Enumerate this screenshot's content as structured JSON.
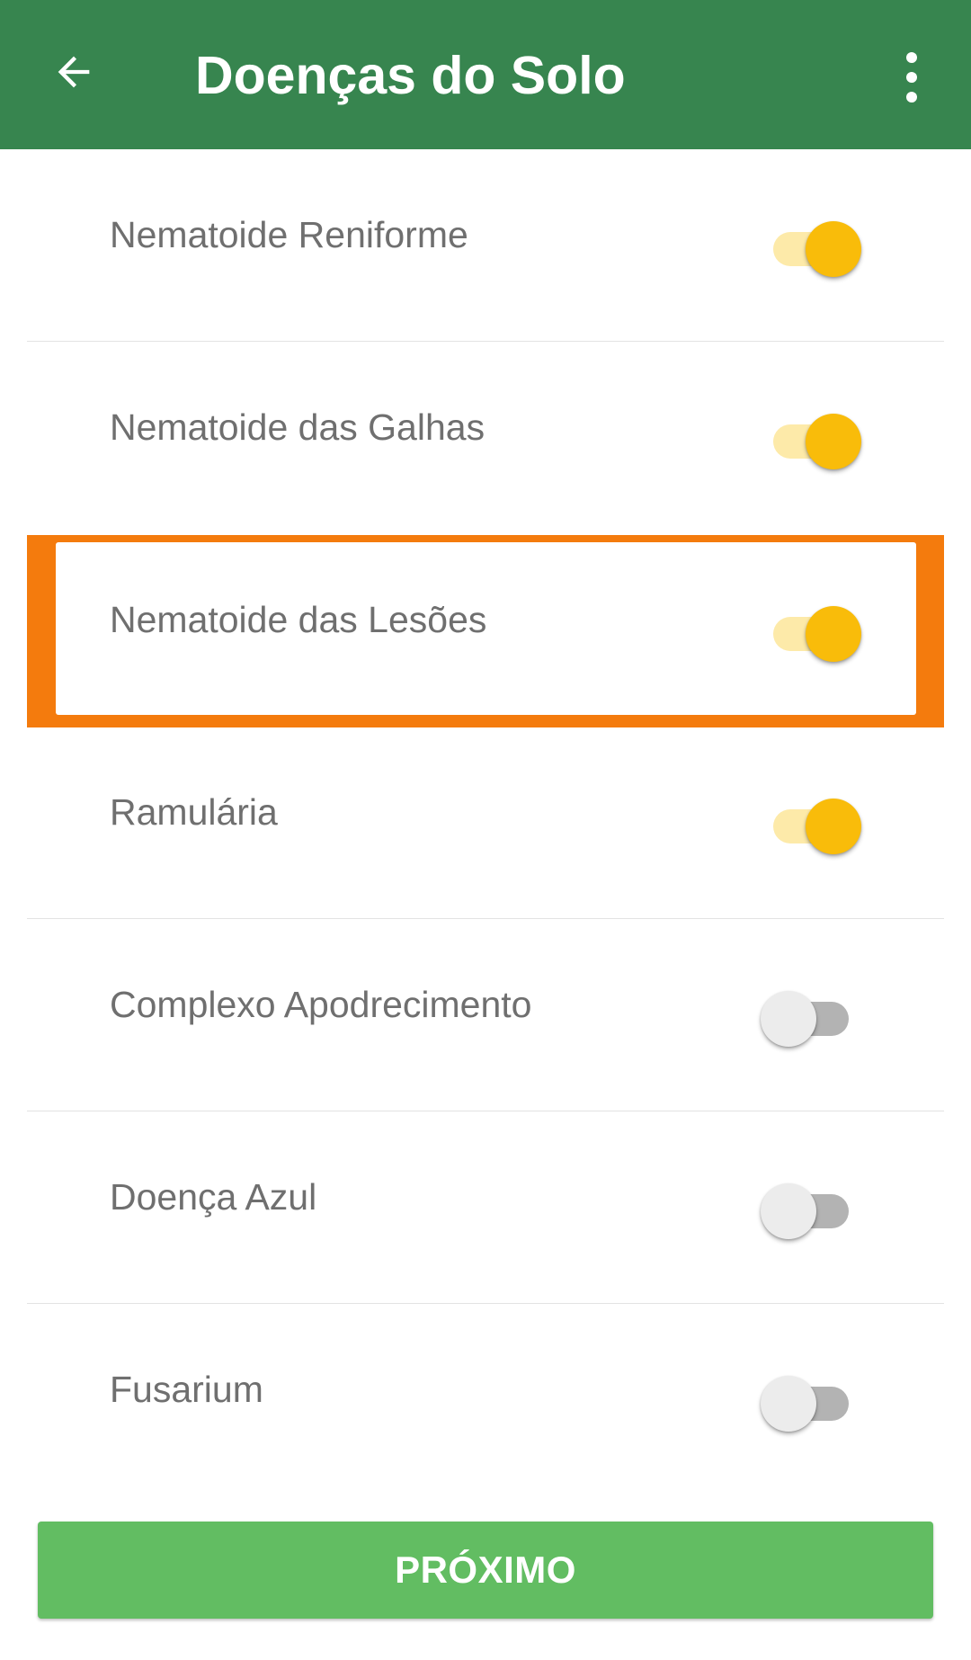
{
  "header": {
    "title": "Doenças do Solo",
    "back_icon": "arrow-left-icon",
    "menu_icon": "more-vert-icon"
  },
  "items": [
    {
      "label": "Nematoide Reniforme",
      "enabled": true
    },
    {
      "label": "Nematoide das Galhas",
      "enabled": true
    },
    {
      "label": "Nematoide das Lesões",
      "enabled": true,
      "highlighted": true
    },
    {
      "label": "Ramulária",
      "enabled": true
    },
    {
      "label": "Complexo Apodrecimento",
      "enabled": false
    },
    {
      "label": "Doença Azul",
      "enabled": false
    },
    {
      "label": "Fusarium",
      "enabled": false
    }
  ],
  "footer": {
    "next_label": "PRÓXIMO"
  },
  "colors": {
    "appbar": "#37854f",
    "switch_on_thumb": "#f9bc0a",
    "switch_on_track": "#fdeaa9",
    "switch_off_thumb": "#ececec",
    "switch_off_track": "#b3b3b3",
    "highlight_border": "#f47b0d",
    "button": "#62bd62"
  }
}
